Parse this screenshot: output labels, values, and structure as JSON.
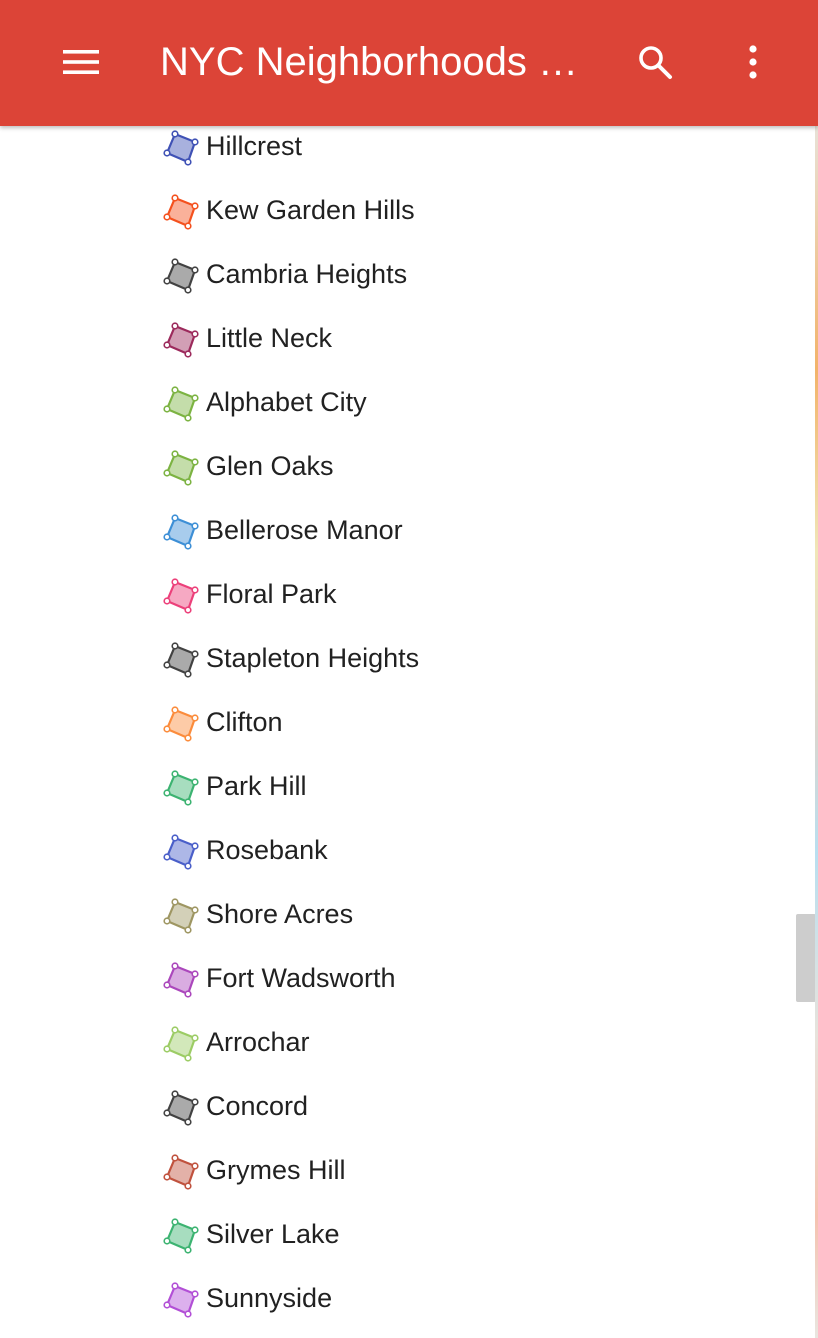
{
  "appbar": {
    "title": "NYC Neighborhoods M…",
    "color": "#dc4437",
    "icons": [
      "menu-icon",
      "search-icon",
      "more-vert-icon"
    ]
  },
  "neighborhoods": [
    {
      "label": "Hillcrest",
      "color": "#3f51b5"
    },
    {
      "label": "Kew Garden Hills",
      "color": "#f4511e"
    },
    {
      "label": "Cambria Heights",
      "color": "#424242"
    },
    {
      "label": "Little Neck",
      "color": "#9c2a5c"
    },
    {
      "label": "Alphabet City",
      "color": "#7cb342"
    },
    {
      "label": "Glen Oaks",
      "color": "#7cb342"
    },
    {
      "label": "Bellerose Manor",
      "color": "#3d8fd6"
    },
    {
      "label": "Floral Park",
      "color": "#ec407a"
    },
    {
      "label": "Stapleton Heights",
      "color": "#424242"
    },
    {
      "label": "Clifton",
      "color": "#fb8c3c"
    },
    {
      "label": "Park Hill",
      "color": "#3cb371"
    },
    {
      "label": "Rosebank",
      "color": "#4a5fc9"
    },
    {
      "label": "Shore Acres",
      "color": "#9e9662"
    },
    {
      "label": "Fort Wadsworth",
      "color": "#ab47bc"
    },
    {
      "label": "Arrochar",
      "color": "#9ccc65"
    },
    {
      "label": "Concord",
      "color": "#424242"
    },
    {
      "label": "Grymes Hill",
      "color": "#c0523e"
    },
    {
      "label": "Silver Lake",
      "color": "#3cb371"
    },
    {
      "label": "Sunnyside",
      "color": "#b24fd6"
    }
  ]
}
